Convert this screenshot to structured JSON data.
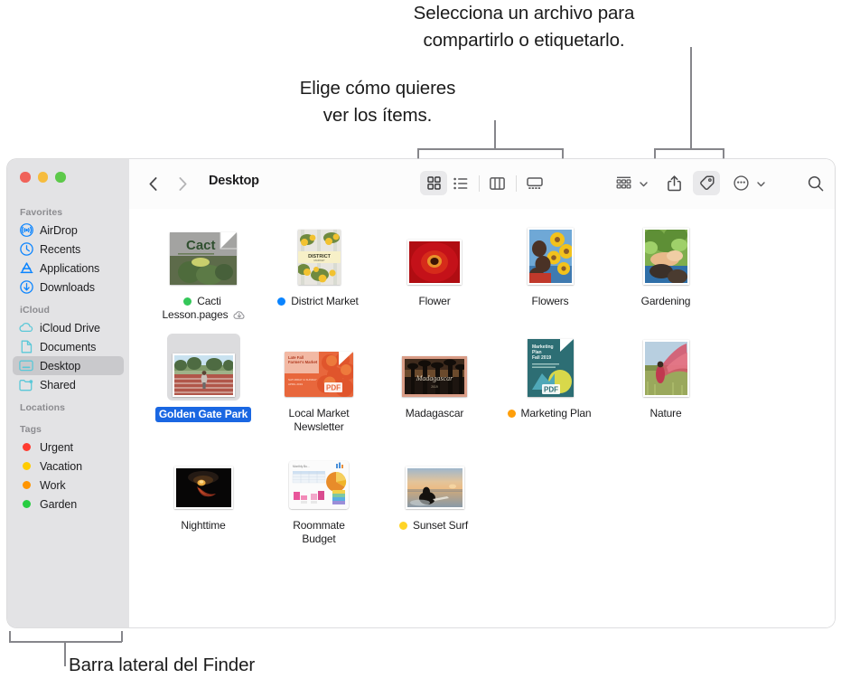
{
  "callouts": {
    "share": "Selecciona un archivo para\ncompartirlo o etiquetarlo.",
    "view": "Elige cómo quieres\nver los ítems.",
    "sidebar": "Barra lateral del Finder"
  },
  "window": {
    "traffic_lights": {
      "close": "close-button",
      "minimize": "minimize-button",
      "zoom": "zoom-button",
      "close_color": "#f0635a",
      "minimize_color": "#f6bc3e",
      "zoom_color": "#5dc94a"
    }
  },
  "toolbar": {
    "back": "back-button",
    "forward": "forward-button",
    "title": "Desktop",
    "views": [
      {
        "name": "icon-view-button",
        "icon": "grid-icon",
        "active": true
      },
      {
        "name": "list-view-button",
        "icon": "list-icon",
        "active": false
      },
      {
        "name": "column-view-button",
        "icon": "columns-icon",
        "active": false
      },
      {
        "name": "gallery-view-button",
        "icon": "gallery-icon",
        "active": false
      }
    ],
    "actions": [
      {
        "name": "group-by-button",
        "icon": "group-icon",
        "active": false,
        "caret": true
      },
      {
        "name": "share-button",
        "icon": "share-icon",
        "active": false,
        "caret": false
      },
      {
        "name": "tag-button",
        "icon": "tag-icon",
        "active": true,
        "caret": false
      },
      {
        "name": "more-button",
        "icon": "ellipsis-circle-icon",
        "active": false,
        "caret": true
      }
    ],
    "search": "search-icon"
  },
  "sidebar": {
    "sections": [
      {
        "title": "Favorites",
        "items": [
          {
            "label": "AirDrop",
            "icon": "airdrop-icon",
            "color": "#0a84ff",
            "selected": false
          },
          {
            "label": "Recents",
            "icon": "clock-icon",
            "color": "#0a84ff",
            "selected": false
          },
          {
            "label": "Applications",
            "icon": "applications-icon",
            "color": "#0a84ff",
            "selected": false
          },
          {
            "label": "Downloads",
            "icon": "download-icon",
            "color": "#0a84ff",
            "selected": false
          }
        ]
      },
      {
        "title": "iCloud",
        "items": [
          {
            "label": "iCloud Drive",
            "icon": "cloud-icon",
            "color": "#5bc8d8",
            "selected": false
          },
          {
            "label": "Documents",
            "icon": "document-icon",
            "color": "#5bc8d8",
            "selected": false
          },
          {
            "label": "Desktop",
            "icon": "desktop-icon",
            "color": "#5bc8d8",
            "selected": true
          },
          {
            "label": "Shared",
            "icon": "shared-folder-icon",
            "color": "#5bc8d8",
            "selected": false
          }
        ]
      },
      {
        "title": "Locations",
        "items": []
      },
      {
        "title": "Tags",
        "items": [
          {
            "label": "Urgent",
            "icon": "tag-dot-icon",
            "color": "#ff3b30",
            "selected": false
          },
          {
            "label": "Vacation",
            "icon": "tag-dot-icon",
            "color": "#ffcc00",
            "selected": false
          },
          {
            "label": "Work",
            "icon": "tag-dot-icon",
            "color": "#ff9500",
            "selected": false
          },
          {
            "label": "Garden",
            "icon": "tag-dot-icon",
            "color": "#28cd41",
            "selected": false
          }
        ]
      }
    ]
  },
  "files": [
    {
      "name": "Cacti\nLesson.pages",
      "tag": "#34c759",
      "selected": false,
      "thumb": "cacti-document",
      "cloud": true
    },
    {
      "name": "District Market",
      "tag": "#0a84ff",
      "selected": false,
      "thumb": "district-market-poster",
      "cloud": false
    },
    {
      "name": "Flower",
      "tag": null,
      "selected": false,
      "thumb": "flower-photo",
      "cloud": false
    },
    {
      "name": "Flowers",
      "tag": null,
      "selected": false,
      "thumb": "flowers-photo",
      "cloud": false
    },
    {
      "name": "Gardening",
      "tag": null,
      "selected": false,
      "thumb": "gardening-photo",
      "cloud": false
    },
    {
      "name": "Golden Gate Park",
      "tag": null,
      "selected": true,
      "thumb": "golden-gate-park-photo",
      "cloud": false
    },
    {
      "name": "Local Market\nNewsletter",
      "tag": null,
      "selected": false,
      "thumb": "local-market-pdf",
      "cloud": false
    },
    {
      "name": "Madagascar",
      "tag": null,
      "selected": false,
      "thumb": "madagascar-photo",
      "cloud": false
    },
    {
      "name": "Marketing Plan",
      "tag": "#ff9f0a",
      "selected": false,
      "thumb": "marketing-plan-pdf",
      "cloud": false
    },
    {
      "name": "Nature",
      "tag": null,
      "selected": false,
      "thumb": "nature-photo",
      "cloud": false
    },
    {
      "name": "Nighttime",
      "tag": null,
      "selected": false,
      "thumb": "nighttime-photo",
      "cloud": false
    },
    {
      "name": "Roommate\nBudget",
      "tag": null,
      "selected": false,
      "thumb": "roommate-budget-numbers",
      "cloud": false
    },
    {
      "name": "Sunset Surf",
      "tag": "#ffd426",
      "selected": false,
      "thumb": "sunset-surf-photo",
      "cloud": false
    }
  ]
}
